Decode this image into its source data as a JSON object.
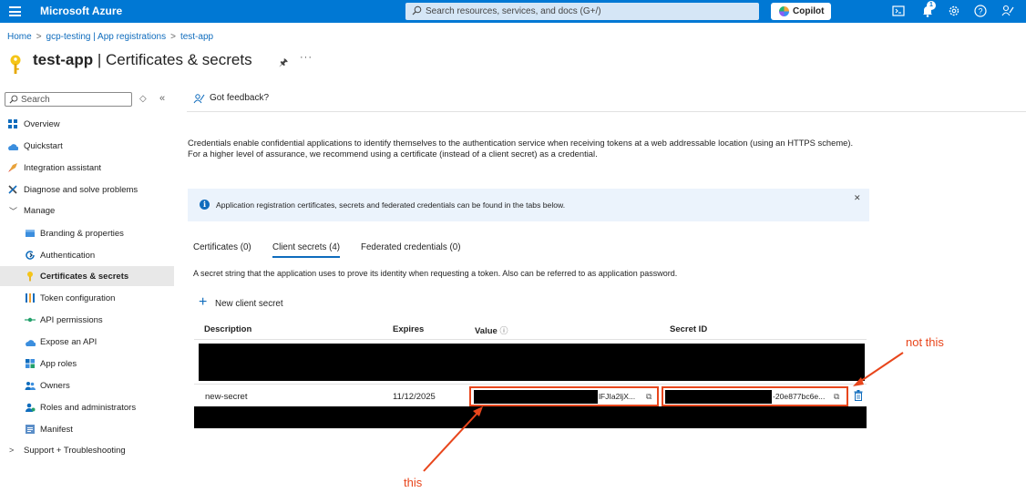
{
  "topbar": {
    "brand": "Microsoft Azure",
    "search_placeholder": "Search resources, services, and docs (G+/)",
    "copilot_label": "Copilot",
    "notification_count": "1"
  },
  "breadcrumb": [
    "Home",
    "gcp-testing | App registrations",
    "test-app"
  ],
  "page": {
    "title_bold": "test-app",
    "title_rest": " | Certificates & secrets"
  },
  "sidebar": {
    "search_placeholder": "Search",
    "items": [
      {
        "label": "Overview",
        "icon": "overview-icon"
      },
      {
        "label": "Quickstart",
        "icon": "quickstart-icon"
      },
      {
        "label": "Integration assistant",
        "icon": "rocket-icon"
      },
      {
        "label": "Diagnose and solve problems",
        "icon": "wrench-icon"
      },
      {
        "label": "Manage",
        "icon": "chevron-down-icon"
      },
      {
        "label": "Branding & properties",
        "icon": "branding-icon"
      },
      {
        "label": "Authentication",
        "icon": "authentication-icon"
      },
      {
        "label": "Certificates & secrets",
        "icon": "key-icon"
      },
      {
        "label": "Token configuration",
        "icon": "token-icon"
      },
      {
        "label": "API permissions",
        "icon": "api-permissions-icon"
      },
      {
        "label": "Expose an API",
        "icon": "cloud-icon"
      },
      {
        "label": "App roles",
        "icon": "app-roles-icon"
      },
      {
        "label": "Owners",
        "icon": "owners-icon"
      },
      {
        "label": "Roles and administrators",
        "icon": "roles-icon"
      },
      {
        "label": "Manifest",
        "icon": "manifest-icon"
      },
      {
        "label": "Support + Troubleshooting",
        "icon": "chevron-right-icon"
      }
    ]
  },
  "main": {
    "feedback_label": "Got feedback?",
    "description": "Credentials enable confidential applications to identify themselves to the authentication service when receiving tokens at a web addressable location (using an HTTPS scheme). For a higher level of assurance, we recommend using a certificate (instead of a client secret) as a credential.",
    "info_message": "Application registration certificates, secrets and federated credentials can be found in the tabs below.",
    "tabs": [
      "Certificates (0)",
      "Client secrets (4)",
      "Federated credentials (0)"
    ],
    "tab_description": "A secret string that the application uses to prove its identity when requesting a token. Also can be referred to as application password.",
    "new_secret_label": "New client secret",
    "columns": [
      "Description",
      "Expires",
      "Value",
      "Secret ID"
    ],
    "row": {
      "description": "new-secret",
      "expires": "11/12/2025",
      "value_suffix": "lFJIa2ljX...",
      "secret_id_suffix": "-20e877bc6e..."
    }
  },
  "annotations": {
    "this": "this",
    "not_this": "not this"
  },
  "colors": {
    "azure_blue": "#0078d4",
    "link_blue": "#0f6cbd",
    "annotation_red": "#e8461c"
  }
}
